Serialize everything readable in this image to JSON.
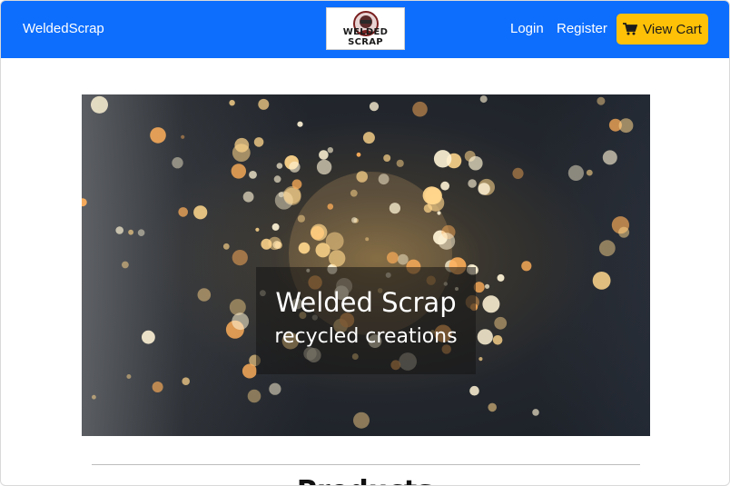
{
  "navbar": {
    "brand": "WeldedScrap",
    "logo_text": "WELDED SCRAP",
    "links": {
      "login": "Login",
      "register": "Register"
    },
    "cart_label": "View Cart",
    "cart_icon": "shopping-cart-icon",
    "colors": {
      "bar": "#0d6efd",
      "cart_button": "#ffc107"
    }
  },
  "hero": {
    "title": "Welded Scrap",
    "subtitle": "recycled creations"
  },
  "section": {
    "heading": "Products"
  }
}
